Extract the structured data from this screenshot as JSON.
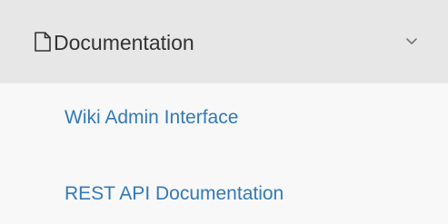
{
  "menu": {
    "header": {
      "icon": "document-icon",
      "label": "Documentation",
      "chevron": "chevron-down-icon",
      "expanded": true
    },
    "items": [
      {
        "label": "Wiki Admin Interface"
      },
      {
        "label": "REST API Documentation"
      }
    ]
  },
  "colors": {
    "header_background": "#e7e7e7",
    "panel_background": "#f8f8f8",
    "header_text": "#333333",
    "link_text": "#337ab7"
  }
}
